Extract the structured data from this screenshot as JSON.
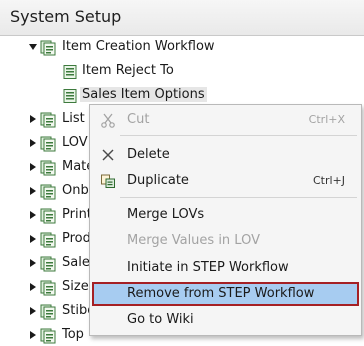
{
  "panel": {
    "title": "System Setup"
  },
  "tree": {
    "root": "Item Creation Workflow",
    "children": [
      "Item Reject To",
      "Sales Item Options"
    ],
    "siblings": [
      "List",
      "LOV",
      "Mate",
      "Onb",
      "Print",
      "Prod",
      "Sale",
      "Size",
      "Stibo",
      "Top"
    ]
  },
  "context_menu": {
    "cut": {
      "label": "Cut",
      "shortcut": "Ctrl+X"
    },
    "delete": {
      "label": "Delete"
    },
    "duplicate": {
      "label": "Duplicate",
      "shortcut": "Ctrl+J"
    },
    "merge_lovs": {
      "label": "Merge LOVs"
    },
    "merge_values": {
      "label": "Merge Values in LOV"
    },
    "initiate": {
      "label": "Initiate in STEP Workflow"
    },
    "remove": {
      "label": "Remove from STEP Workflow"
    },
    "wiki": {
      "label": "Go to Wiki"
    }
  },
  "colors": {
    "highlight_fill": "#a7ccf1",
    "highlight_border": "#a52024"
  }
}
